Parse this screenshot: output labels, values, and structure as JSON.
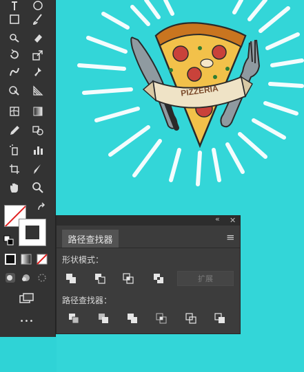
{
  "artwork": {
    "banner_text": "PIZZERIA"
  },
  "pathfinder_panel": {
    "tab_label": "路径查找器",
    "shape_modes_label": "形状模式：",
    "expand_label": "扩展",
    "pathfinders_label": "路径查找器：",
    "collapse_glyph": "«",
    "close_glyph": "✕",
    "menu_glyph": "≡"
  },
  "toolbar": {
    "more_tools_glyph": "•••"
  },
  "colors": {
    "canvas": "#33d6d8",
    "toolbar_bg": "#333333",
    "panel_bg": "#3c3c3c",
    "fill_none_slash": "#e02020"
  }
}
